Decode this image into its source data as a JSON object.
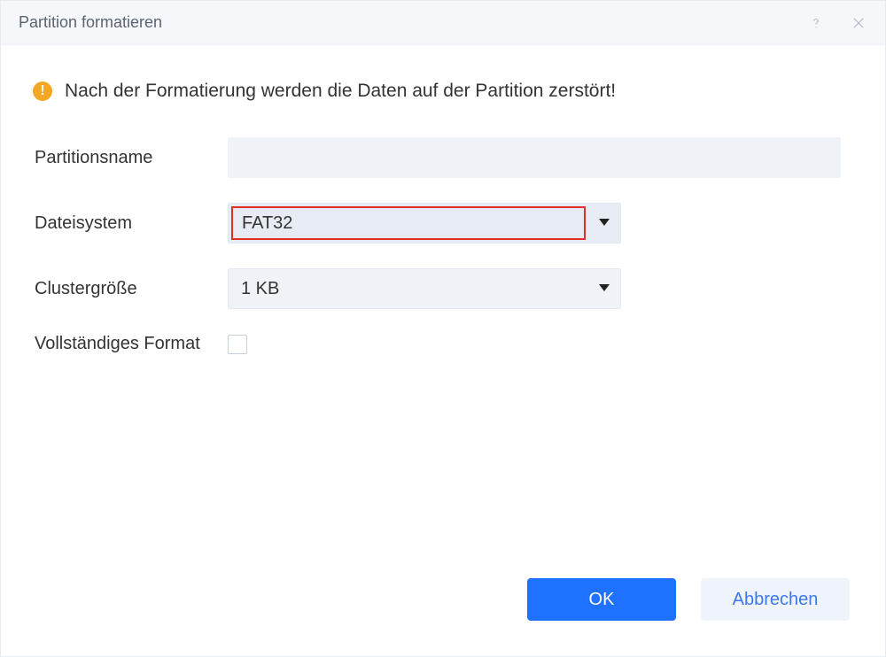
{
  "titlebar": {
    "title": "Partition formatieren"
  },
  "warning": {
    "text": "Nach der Formatierung werden die Daten auf der Partition zerstört!"
  },
  "form": {
    "partition_name_label": "Partitionsname",
    "partition_name_value": "",
    "filesystem_label": "Dateisystem",
    "filesystem_value": "FAT32",
    "cluster_label": "Clustergröße",
    "cluster_value": "1 KB",
    "full_format_label": "Vollständiges Format",
    "full_format_checked": false
  },
  "footer": {
    "ok_label": "OK",
    "cancel_label": "Abbrechen"
  }
}
